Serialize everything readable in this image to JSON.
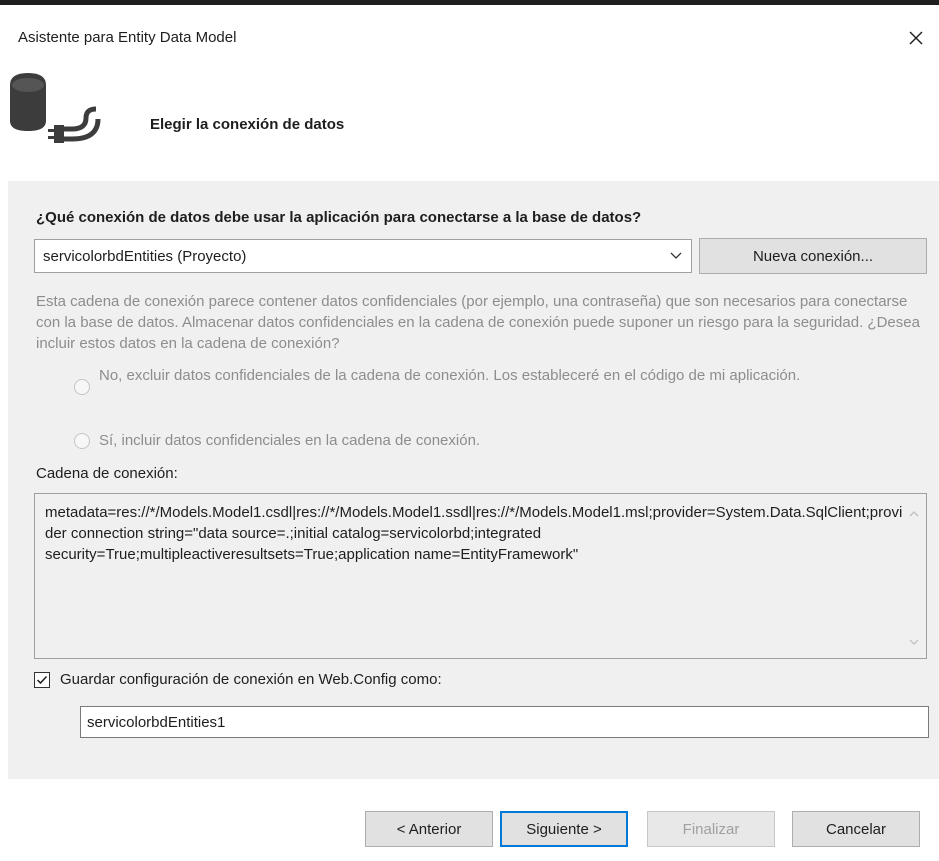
{
  "window": {
    "title": "Asistente para Entity Data Model",
    "close_glyph": "✕"
  },
  "header": {
    "title": "Elegir la conexión de datos",
    "icon": "database-plug-icon"
  },
  "main": {
    "question": "¿Qué conexión de datos debe usar la aplicación para conectarse a la base de datos?",
    "connection_select": {
      "value": "servicolorbdEntities (Proyecto)"
    },
    "new_connection_label": "Nueva conexión...",
    "warning_text": "Esta cadena de conexión parece contener datos confidenciales (por ejemplo, una contraseña) que son necesarios para conectarse con la base de datos. Almacenar datos confidenciales en la cadena de conexión puede suponer un riesgo para la seguridad. ¿Desea incluir estos datos en la cadena de conexión?",
    "radio_exclude_label": "No, excluir datos confidenciales de la cadena de conexión. Los estableceré en el código de mi aplicación.",
    "radio_include_label": "Sí, incluir datos confidenciales en la cadena de conexión.",
    "connection_string_label": "Cadena de conexión:",
    "connection_string": "metadata=res://*/Models.Model1.csdl|res://*/Models.Model1.ssdl|res://*/Models.Model1.msl;provider=System.Data.SqlClient;provider connection string=\"data source=.;initial catalog=servicolorbd;integrated security=True;multipleactiveresultsets=True;application name=EntityFramework\"",
    "save_checkbox": {
      "label": "Guardar configuración de conexión en Web.Config como:",
      "checked": true
    },
    "entities_name_value": "servicolorbdEntities1"
  },
  "footer": {
    "prev_label": "< Anterior",
    "next_label": "Siguiente >",
    "finish_label": "Finalizar",
    "cancel_label": "Cancelar"
  },
  "colors": {
    "accent": "#0078d7",
    "panel_bg": "#f0f0f0",
    "disabled_text": "#8d8d8d"
  }
}
